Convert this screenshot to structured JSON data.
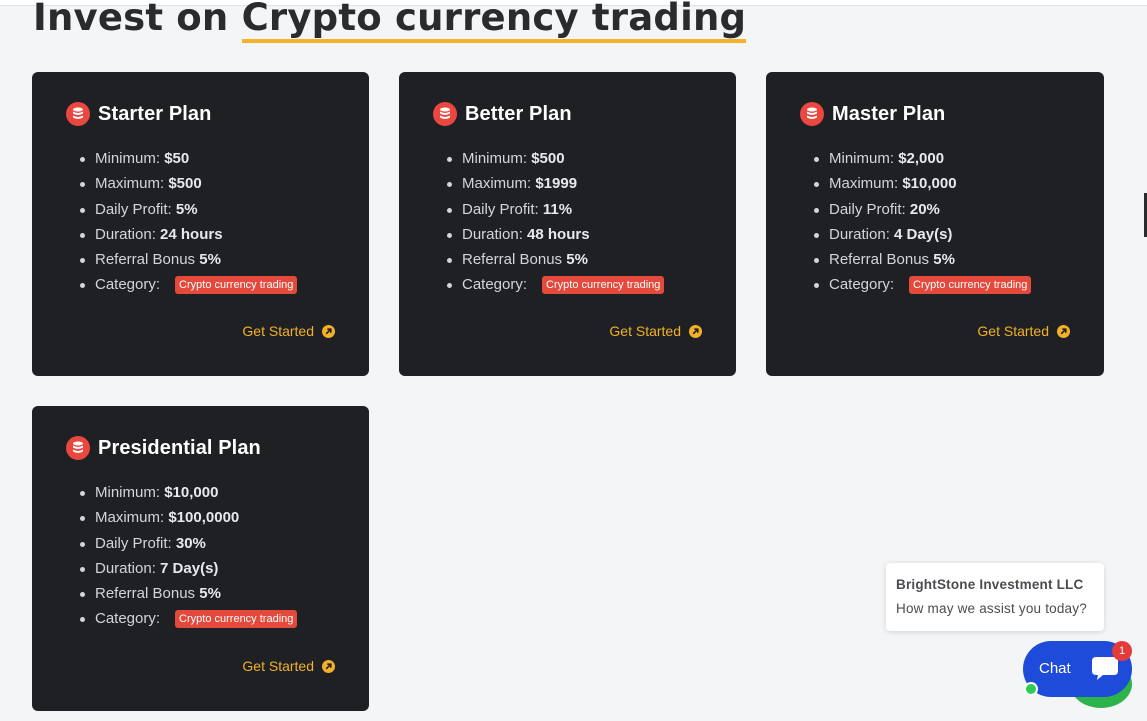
{
  "heading": {
    "prefix": "Invest on ",
    "highlight": "Crypto currency trading"
  },
  "plans": [
    {
      "title": "Starter Plan",
      "minimum_label": "Minimum:",
      "minimum": "$50",
      "maximum_label": "Maximum:",
      "maximum": "$500",
      "daily_profit_label": "Daily Profit:",
      "daily_profit": "5%",
      "duration_label": "Duration:",
      "duration": "24 hours",
      "referral_label": "Referral Bonus",
      "referral": "5%",
      "category_label": "Category:",
      "category": "Crypto currency trading",
      "cta": "Get Started"
    },
    {
      "title": "Better Plan",
      "minimum_label": "Minimum:",
      "minimum": "$500",
      "maximum_label": "Maximum:",
      "maximum": "$1999",
      "daily_profit_label": "Daily Profit:",
      "daily_profit": "11%",
      "duration_label": "Duration:",
      "duration": "48 hours",
      "referral_label": "Referral Bonus",
      "referral": "5%",
      "category_label": "Category:",
      "category": "Crypto currency trading",
      "cta": "Get Started"
    },
    {
      "title": "Master Plan",
      "minimum_label": "Minimum:",
      "minimum": "$2,000",
      "maximum_label": "Maximum:",
      "maximum": "$10,000",
      "daily_profit_label": "Daily Profit:",
      "daily_profit": "20%",
      "duration_label": "Duration:",
      "duration": "4 Day(s)",
      "referral_label": "Referral Bonus",
      "referral": "5%",
      "category_label": "Category:",
      "category": "Crypto currency trading",
      "cta": "Get Started"
    },
    {
      "title": "Presidential Plan",
      "minimum_label": "Minimum:",
      "minimum": "$10,000",
      "maximum_label": "Maximum:",
      "maximum": "$100,0000",
      "daily_profit_label": "Daily Profit:",
      "daily_profit": "30%",
      "duration_label": "Duration:",
      "duration": "7 Day(s)",
      "referral_label": "Referral Bonus",
      "referral": "5%",
      "category_label": "Category:",
      "category": "Crypto currency trading",
      "cta": "Get Started"
    }
  ],
  "chat": {
    "company": "BrightStone Investment LLC",
    "message": "How may we assist you today?",
    "button_label": "Chat",
    "badge_count": "1"
  },
  "icons": {
    "plan_icon": "coins-icon",
    "cta_icon": "arrow-circle-icon",
    "chat_icon": "speech-bubble-icon"
  },
  "colors": {
    "card_bg": "#1f2024",
    "accent": "#f3b028",
    "badge_red": "#e44a3c",
    "chat_blue": "#1e4bd9",
    "online_green": "#2ecc55"
  }
}
